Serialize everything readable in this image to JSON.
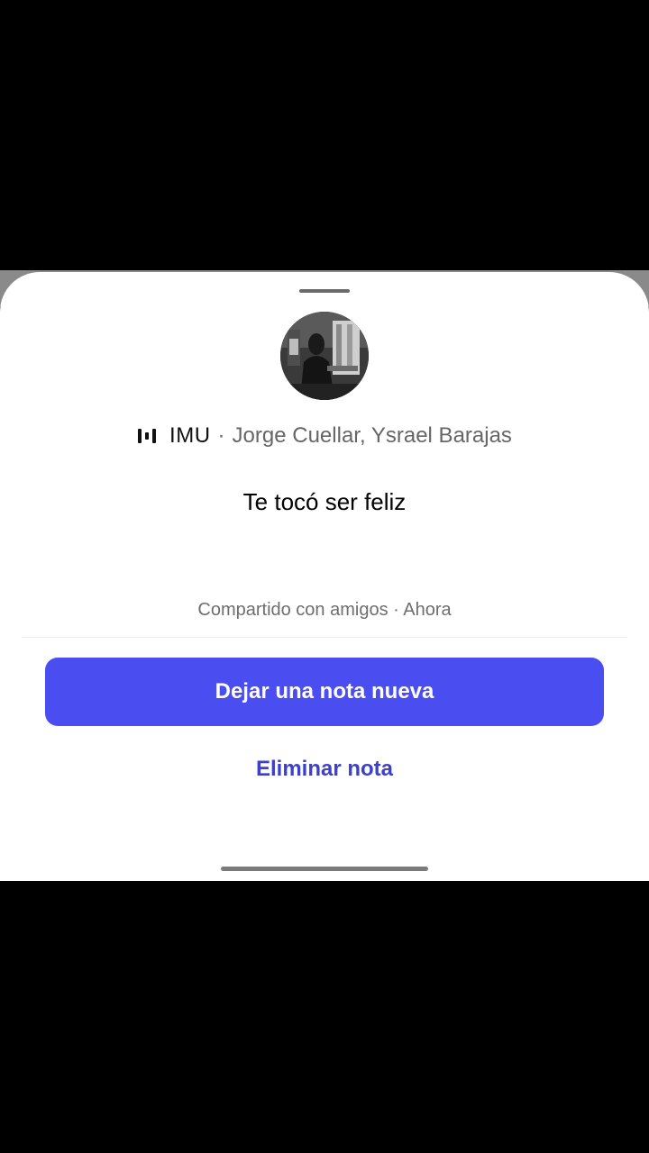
{
  "note_sheet": {
    "music": {
      "icon": "music-bars-icon",
      "title": "IMU",
      "separator": "·",
      "artists": "Jorge Cuellar, Ysrael Barajas"
    },
    "note_text": "Te tocó ser feliz",
    "shared_line": "Compartido con amigos · Ahora",
    "primary_action": "Dejar una nota nueva",
    "secondary_action": "Eliminar nota"
  },
  "colors": {
    "primary_button": "#4a4df0",
    "link": "#3d40c9",
    "sheet_background": "#ffffff",
    "screen_background": "#000000"
  }
}
